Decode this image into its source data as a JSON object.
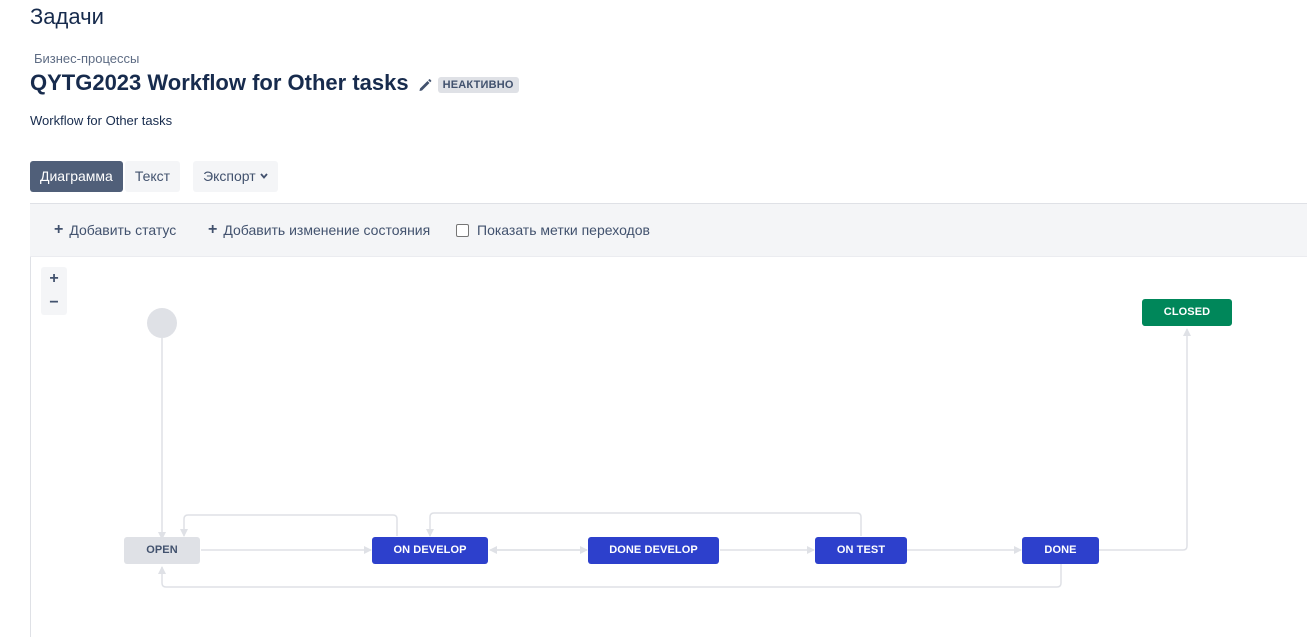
{
  "page": {
    "title": "Задачи"
  },
  "breadcrumb": "Бизнес-процессы",
  "workflow": {
    "name": "QYTG2023 Workflow for Other tasks",
    "status": "НЕАКТИВНО",
    "description": "Workflow for Other tasks"
  },
  "view_tabs": {
    "diagram": "Диаграмма",
    "text": "Текст",
    "export": "Экспорт"
  },
  "toolbar": {
    "add_status": "Добавить статус",
    "add_transition": "Добавить изменение состояния",
    "show_labels": "Показать метки переходов",
    "show_labels_checked": false
  },
  "zoom": {
    "in": "+",
    "out": "−"
  },
  "diagram": {
    "statuses": {
      "open": "OPEN",
      "on_develop": "ON DEVELOP",
      "done_develop": "DONE DEVELOP",
      "on_test": "ON TEST",
      "done": "DONE",
      "closed": "CLOSED"
    }
  },
  "colors": {
    "todo": "#dfe1e6",
    "in_progress": "#2d40cc",
    "done": "#00875a",
    "active_tab": "#505f79"
  },
  "icons": {
    "edit": "pencil-icon",
    "export_chevron": "chevron-down-icon"
  }
}
